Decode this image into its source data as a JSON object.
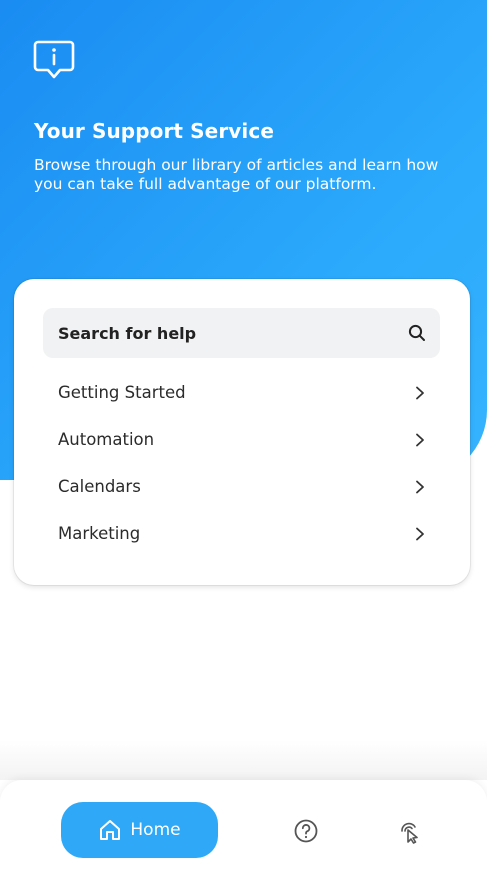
{
  "hero": {
    "icon": "info-chat-icon",
    "title": "Your Support Service",
    "subtitle": "Browse through our library of articles and learn how you can take full advantage of our platform."
  },
  "search": {
    "label": "Search for help",
    "icon": "search-icon"
  },
  "menu": {
    "items": [
      {
        "label": "Getting Started",
        "icon": "chevron-right-icon"
      },
      {
        "label": "Automation",
        "icon": "chevron-right-icon"
      },
      {
        "label": "Calendars",
        "icon": "chevron-right-icon"
      },
      {
        "label": "Marketing",
        "icon": "chevron-right-icon"
      }
    ]
  },
  "tabbar": {
    "home_label": "Home",
    "home_icon": "home-icon",
    "help_icon": "help-circle-icon",
    "click_icon": "pointer-click-icon"
  },
  "colors": {
    "hero_start": "#1a8cf2",
    "hero_end": "#36b4ff",
    "accent": "#2ea8f7"
  }
}
